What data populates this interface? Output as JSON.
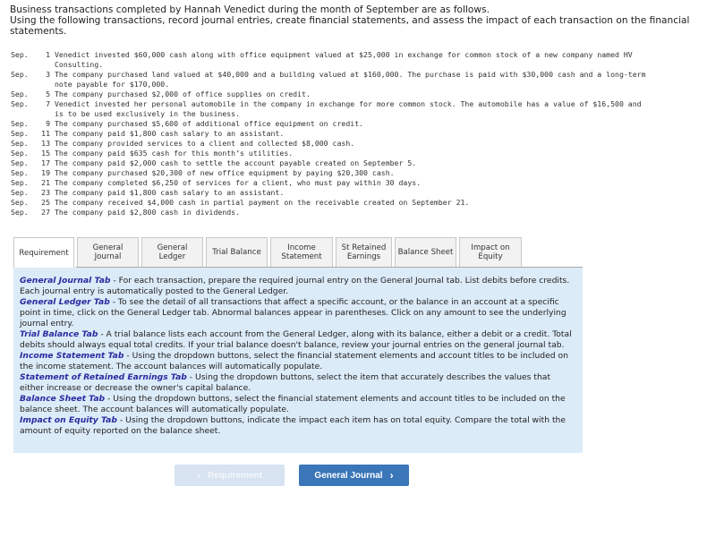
{
  "intro": {
    "line1": "Business transactions completed by Hannah Venedict during the month of September are as follows.",
    "line2": "Using the following transactions, record journal entries, create financial statements, and assess the impact of each transaction on the financial statements."
  },
  "transactions": [
    {
      "month": "Sep.",
      "day": "1",
      "text": "Venedict invested $60,000 cash along with office equipment valued at $25,000 in exchange for common stock of a new company named HV Consulting."
    },
    {
      "month": "Sep.",
      "day": "3",
      "text": "The company purchased land valued at $40,000 and a building valued at $160,000. The purchase is paid with $30,000 cash and a long-term note payable for $170,000."
    },
    {
      "month": "Sep.",
      "day": "5",
      "text": "The company purchased $2,000 of office supplies on credit."
    },
    {
      "month": "Sep.",
      "day": "7",
      "text": "Venedict invested her personal automobile in the company in exchange for more common stock. The automobile has a value of $16,500 and is to be used exclusively in the business."
    },
    {
      "month": "Sep.",
      "day": "9",
      "text": "The company purchased $5,600 of additional office equipment on credit."
    },
    {
      "month": "Sep.",
      "day": "11",
      "text": "The company paid $1,800 cash salary to an assistant."
    },
    {
      "month": "Sep.",
      "day": "13",
      "text": "The company provided services to a client and collected $8,000 cash."
    },
    {
      "month": "Sep.",
      "day": "15",
      "text": "The company paid $635 cash for this month’s utilities."
    },
    {
      "month": "Sep.",
      "day": "17",
      "text": "The company paid $2,000 cash to settle the account payable created on September 5."
    },
    {
      "month": "Sep.",
      "day": "19",
      "text": "The company purchased $20,300 of new office equipment by paying $20,300 cash."
    },
    {
      "month": "Sep.",
      "day": "21",
      "text": "The company completed $6,250 of services for a client, who must pay within 30 days."
    },
    {
      "month": "Sep.",
      "day": "23",
      "text": "The company paid $1,800 cash salary to an assistant."
    },
    {
      "month": "Sep.",
      "day": "25",
      "text": "The company received $4,000 cash in partial payment on the receivable created on September 21."
    },
    {
      "month": "Sep.",
      "day": "27",
      "text": "The company paid $2,800 cash in dividends."
    }
  ],
  "tabs": [
    {
      "line1": "Requirement",
      "line2": "",
      "active": true
    },
    {
      "line1": "General",
      "line2": "Journal",
      "active": false
    },
    {
      "line1": "General",
      "line2": "Ledger",
      "active": false
    },
    {
      "line1": "Trial Balance",
      "line2": "",
      "active": false
    },
    {
      "line1": "Income",
      "line2": "Statement",
      "active": false
    },
    {
      "line1": "St Retained",
      "line2": "Earnings",
      "active": false
    },
    {
      "line1": "Balance Sheet",
      "line2": "",
      "active": false
    },
    {
      "line1": "Impact on",
      "line2": "Equity",
      "active": false
    }
  ],
  "info": [
    {
      "keyword": "General Journal Tab",
      "text": " - For each transaction, prepare the required journal entry on the General Journal tab. List debits before credits. Each journal entry is automatically posted to the General Ledger."
    },
    {
      "keyword": "General Ledger Tab",
      "text": " - To see the detail of all transactions that affect a specific account, or the balance in an account at a specific point in time, click on the General Ledger tab. Abnormal balances appear in parentheses. Click on any amount to see the underlying journal entry."
    },
    {
      "keyword": "Trial Balance Tab",
      "text": " - A trial balance lists each account from the General Ledger, along with its balance, either a debit or a credit. Total debits should always equal total credits. If your trial balance doesn't balance, review your journal entries on the general journal tab."
    },
    {
      "keyword": "Income Statement Tab",
      "text": " - Using the dropdown buttons, select the financial statement elements and account titles to be included on the income statement. The account balances will automatically populate."
    },
    {
      "keyword": "Statement of Retained Earnings Tab",
      "text": " - Using the dropdown buttons, select the item that accurately describes the values that either increase or decrease the owner's capital balance."
    },
    {
      "keyword": "Balance Sheet Tab",
      "text": " - Using the dropdown buttons, select the financial statement elements and account titles to be included on the balance sheet. The account balances will automatically populate."
    },
    {
      "keyword": "Impact on Equity Tab",
      "text": " - Using the dropdown buttons, indicate the impact each item has on total equity. Compare the total with the amount of equity reported on the balance sheet."
    }
  ],
  "nav": {
    "prev_label": "Requirement",
    "prev_disabled": true,
    "next_label": "General Journal"
  },
  "colors": {
    "info_bg": "#dcebf8",
    "keyword": "#2b2ba0",
    "next_button": "#3a76b8",
    "prev_button_disabled": "#d7e3f1"
  }
}
